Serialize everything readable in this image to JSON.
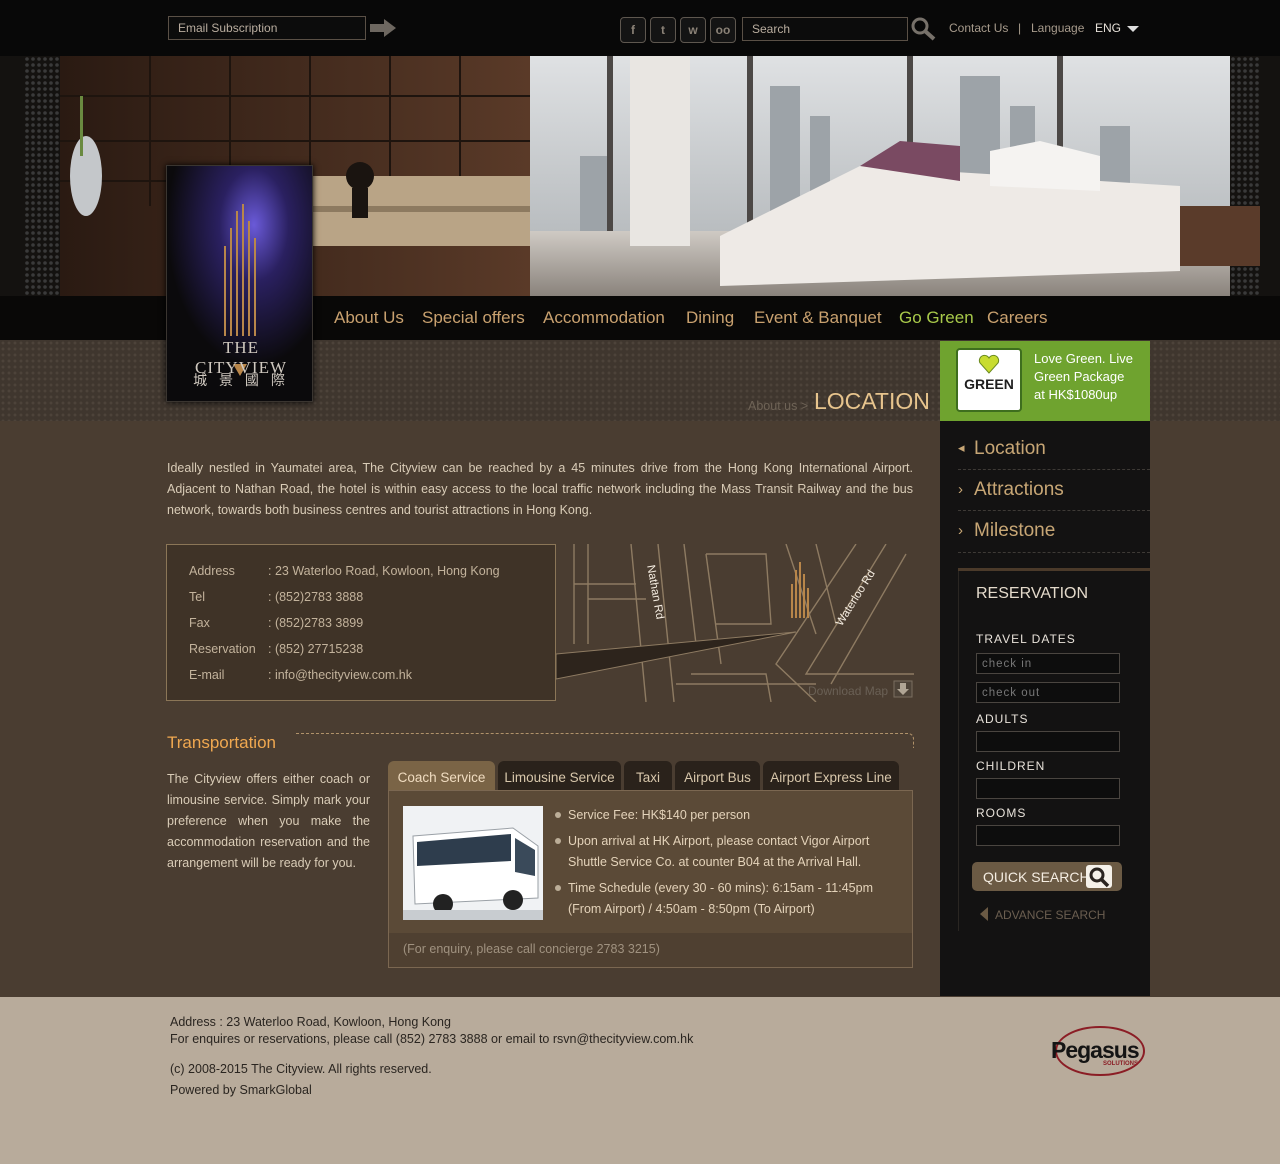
{
  "header": {
    "email_placeholder": "Email Subscription",
    "search_placeholder": "Search",
    "contact_us": "Contact Us",
    "divider": "|",
    "language_label": "Language",
    "language_value": "ENG"
  },
  "logo": {
    "brand": "THE CITYVIEW",
    "chinese": "城 景 國 際"
  },
  "nav": {
    "items": [
      "About Us",
      "Special offers",
      "Accommodation",
      "Dining",
      "Event & Banquet",
      "Go Green",
      "Careers"
    ]
  },
  "breadcrumb": {
    "parent": "About us >",
    "current": "LOCATION"
  },
  "promo": {
    "badge": "GREEN",
    "line1": "Love Green. Live",
    "line2": "Green Package",
    "line3": "at HK$1080up"
  },
  "intro": "Ideally nestled in Yaumatei area, The Cityview can be reached by a 45 minutes drive from the Hong Kong International Airport. Adjacent to Nathan Road, the hotel is within easy access to the local traffic network including the Mass Transit Railway and the bus network, towards both business centres and tourist attractions in Hong Kong.",
  "contact": {
    "rows": [
      {
        "label": "Address",
        "value": ": 23 Waterloo Road, Kowloon, Hong Kong"
      },
      {
        "label": "Tel",
        "value": ": (852)2783 3888"
      },
      {
        "label": "Fax",
        "value": ": (852)2783 3899"
      },
      {
        "label": "Reservation",
        "value": ": (852) 27715238"
      },
      {
        "label": "E-mail",
        "value": ": info@thecityview.com.hk"
      }
    ]
  },
  "map": {
    "street1": "Nathan Rd",
    "street2": "Waterloo Rd",
    "download": "Download Map"
  },
  "transport": {
    "title": "Transportation",
    "description": "The Cityview offers either coach or limousine service. Simply mark your preference when you make the accommodation reservation and the arrangement will be ready for you.",
    "tabs": [
      "Coach Service",
      "Limousine Service",
      "Taxi",
      "Airport Bus",
      "Airport Express Line"
    ],
    "bullets": [
      "Service Fee:  HK$140 per person",
      "Upon arrival at HK Airport, please contact Vigor Airport Shuttle Service Co. at counter B04 at the Arrival Hall.",
      "Time Schedule (every 30 - 60 mins): 6:15am - 11:45pm (From Airport) / 4:50am - 8:50pm (To Airport)"
    ],
    "enquiry": "(For enquiry, please call concierge  2783 3215)"
  },
  "sidebar": {
    "items": [
      "Location",
      "Attractions",
      "Milestone"
    ],
    "markers": [
      "◂",
      "›",
      "›"
    ]
  },
  "reservation": {
    "title": "RESERVATION",
    "travel_dates": "TRAVEL DATES",
    "checkin": "check in",
    "checkout": "check out",
    "adults": "ADULTS",
    "children": "CHILDREN",
    "rooms": "ROOMS",
    "quick_search": "QUICK SEARCH",
    "advance_search": "ADVANCE SEARCH"
  },
  "footer": {
    "address": "Address : 23 Waterloo Road, Kowloon, Hong Kong",
    "enquiry": "For enquires or reservations, please call (852) 2783 3888 or email to rsvn@thecityview.com.hk",
    "copyright": "(c) 2008-2015 The Cityview. All rights reserved.",
    "powered": "Powered by SmarkGlobal",
    "partner_logo": "Pegasus",
    "partner_sub": "SOLUTIONS"
  },
  "colors": {
    "accent": "#c9a16f",
    "go_green": "#a8c94a",
    "transport_title": "#f0a850",
    "promo_green": "#6fa32f"
  }
}
